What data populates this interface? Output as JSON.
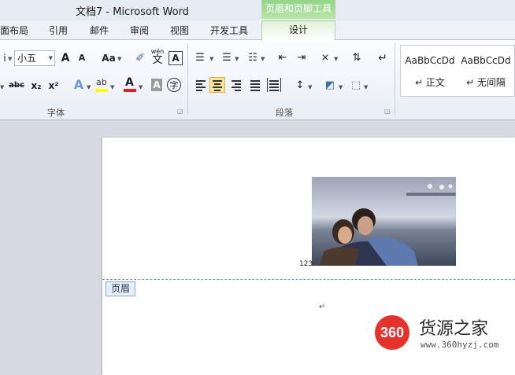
{
  "window": {
    "title": "文档7 - Microsoft Word"
  },
  "context_tab_group": {
    "title": "页眉和页脚工具"
  },
  "tabs": [
    {
      "label": "面布局"
    },
    {
      "label": "引用"
    },
    {
      "label": "邮件"
    },
    {
      "label": "审阅"
    },
    {
      "label": "视图"
    },
    {
      "label": "开发工具"
    },
    {
      "label": "设计"
    }
  ],
  "font_group": {
    "font_size": "小五",
    "label": "字体",
    "buttons": {
      "grow": "A",
      "shrink": "A",
      "change_case": "Aa",
      "phonetic": "wén",
      "phonetic_char": "文",
      "border_char": "A",
      "strike": "abc",
      "subscript": "x₂",
      "superscript": "x²",
      "font_color": "A",
      "char_shading": "A",
      "enclose": "字"
    }
  },
  "paragraph_group": {
    "label": "段落"
  },
  "styles_group": {
    "items": [
      {
        "sample": "AaBbCcDd",
        "name": "↵ 正文"
      },
      {
        "sample": "AaBbCcDd",
        "name": "↵ 无间隔"
      }
    ]
  },
  "document": {
    "page_number": "123",
    "header_label": "页眉",
    "paragraph_mark": "↵"
  },
  "watermark": {
    "badge": "360",
    "brand": "货源之家",
    "url": "www.360hyzj.com"
  },
  "colors": {
    "context_tab": "#94d58a",
    "font_color_underline": "#e02020",
    "highlight": "#ffff00",
    "header_tag_border": "#8fa7c8",
    "watermark_red": "#e5322d"
  }
}
